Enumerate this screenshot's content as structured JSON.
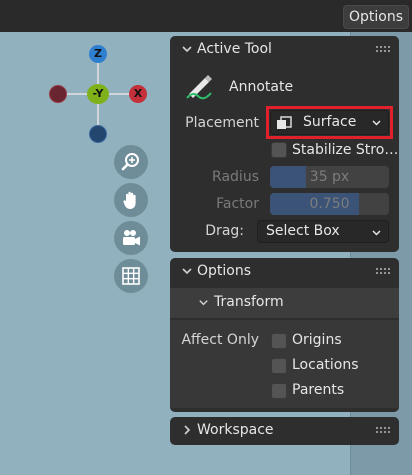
{
  "topbar": {
    "options_button": "Options"
  },
  "gizmo": {
    "z_label": "Z",
    "y_label": "-Y",
    "x_label": "X"
  },
  "nav_icons": [
    "zoom-icon",
    "hand-pan-icon",
    "camera-icon",
    "grid-icon"
  ],
  "active_tool": {
    "title": "Active Tool",
    "tool_name": "Annotate",
    "placement_label": "Placement",
    "placement_value": "Surface",
    "stabilize_label": "Stabilize Stro…",
    "stabilize_checked": false,
    "radius_label": "Radius",
    "radius_value": "35 px",
    "radius_fill": 0.3,
    "factor_label": "Factor",
    "factor_value": "0.750",
    "factor_fill": 0.75,
    "drag_label": "Drag:",
    "drag_value": "Select Box"
  },
  "options_panel": {
    "title": "Options",
    "transform_title": "Transform",
    "affect_only_label": "Affect Only",
    "checkboxes": [
      {
        "label": "Origins",
        "checked": false
      },
      {
        "label": "Locations",
        "checked": false
      },
      {
        "label": "Parents",
        "checked": false
      }
    ]
  },
  "workspace_panel": {
    "title": "Workspace"
  },
  "colors": {
    "highlight_box": "#e0202a",
    "axis_x": "#c4313b",
    "axis_y": "#7fb21a",
    "axis_z": "#2f7fd0",
    "slider_fill": "#4772b3"
  }
}
